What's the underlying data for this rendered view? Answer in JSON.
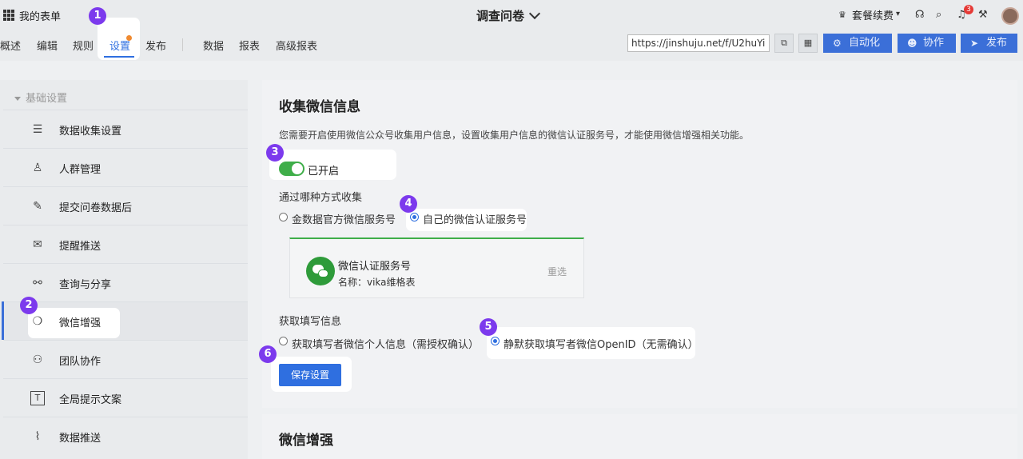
{
  "topbar": {
    "app_name": "我的表单",
    "form_title": "调查问卷",
    "plan_label": "套餐续费",
    "notification_count": "3"
  },
  "nav": {
    "tabs": [
      "概述",
      "编辑",
      "规则",
      "设置",
      "发布",
      "数据",
      "报表",
      "高级报表"
    ],
    "active_tab": "设置"
  },
  "share": {
    "url": "https://jinshuju.net/f/U2huYi",
    "automation_label": "自动化",
    "collab_label": "协作",
    "publish_label": "发布"
  },
  "sidebar": {
    "group_label": "基础设置",
    "items": [
      {
        "label": "数据收集设置",
        "icon": "document-icon"
      },
      {
        "label": "人群管理",
        "icon": "user-icon"
      },
      {
        "label": "提交问卷数据后",
        "icon": "edit-doc-icon"
      },
      {
        "label": "提醒推送",
        "icon": "send-icon"
      },
      {
        "label": "查询与分享",
        "icon": "share-icon"
      },
      {
        "label": "微信增强",
        "icon": "wechat-icon"
      },
      {
        "label": "团队协作",
        "icon": "team-icon"
      },
      {
        "label": "全局提示文案",
        "icon": "text-icon"
      },
      {
        "label": "数据推送",
        "icon": "chart-icon"
      }
    ],
    "active_item": "微信增强"
  },
  "main": {
    "section_title": "收集微信信息",
    "description": "您需要开启使用微信公众号收集用户信息，设置收集用户信息的微信认证服务号，才能使用微信增强相关功能。",
    "toggle_label": "已开启",
    "toggle_on": true,
    "method_title": "通过哪种方式收集",
    "method_options": [
      "金数据官方微信服务号",
      "自己的微信认证服务号"
    ],
    "method_selected": "自己的微信认证服务号",
    "wechat_card": {
      "title": "微信认证服务号",
      "account_name": "名称：vika维格表",
      "reselect_label": "重选"
    },
    "info_title": "获取填写信息",
    "info_options": [
      "获取填写者微信个人信息（需授权确认）",
      "静默获取填写者微信OpenID（无需确认）"
    ],
    "info_selected": "静默获取填写者微信OpenID（无需确认）",
    "save_label": "保存设置",
    "section2_title": "微信增强"
  },
  "callouts": [
    "1",
    "2",
    "3",
    "4",
    "5",
    "6"
  ],
  "colors": {
    "accent": "#2f6fe0",
    "toggle_on": "#3fae49",
    "callout": "#7c3aed"
  }
}
